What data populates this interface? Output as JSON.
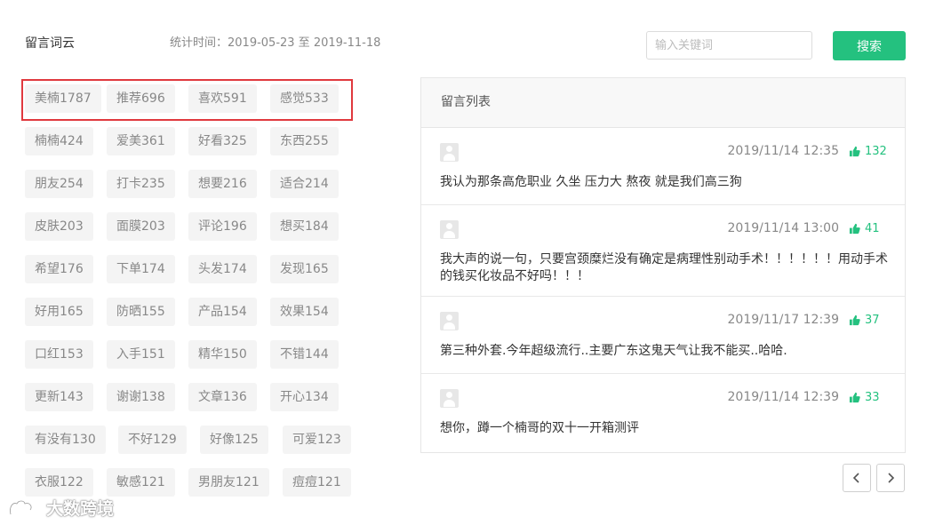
{
  "header": {
    "title": "留言词云",
    "date_range": "统计时间：2019-05-23 至 2019-11-18",
    "search_placeholder": "输入关键词",
    "search_button": "搜索"
  },
  "tags": [
    [
      "美楠1787",
      "推荐696",
      "喜欢591",
      "感觉533"
    ],
    [
      "楠楠424",
      "爱美361",
      "好看325",
      "东西255"
    ],
    [
      "朋友254",
      "打卡235",
      "想要216",
      "适合214"
    ],
    [
      "皮肤203",
      "面膜203",
      "评论196",
      "想买184"
    ],
    [
      "希望176",
      "下单174",
      "头发174",
      "发现165"
    ],
    [
      "好用165",
      "防晒155",
      "产品154",
      "效果154"
    ],
    [
      "口红153",
      "入手151",
      "精华150",
      "不错144"
    ],
    [
      "更新143",
      "谢谢138",
      "文章136",
      "开心134"
    ],
    [
      "有没有130",
      "不好129",
      "好像125",
      "可爱123"
    ],
    [
      "衣服122",
      "敏感121",
      "男朋友121",
      "痘痘121"
    ]
  ],
  "comments_panel": {
    "title": "留言列表",
    "comments": [
      {
        "time": "2019/11/14 12:35",
        "likes": "132",
        "text": "我认为那条高危职业 久坐 压力大 熬夜 就是我们高三狗"
      },
      {
        "time": "2019/11/14 13:00",
        "likes": "41",
        "text": "我大声的说一句，只要宫颈糜烂没有确定是病理性别动手术！！！！！！用动手术的钱买化妆品不好吗！！！"
      },
      {
        "time": "2019/11/17 12:39",
        "likes": "37",
        "text": "第三种外套.今年超级流行..主要广东这鬼天气让我不能买..哈哈."
      },
      {
        "time": "2019/11/14 12:39",
        "likes": "33",
        "text": "想你，蹲一个楠哥的双十一开箱测评"
      }
    ]
  },
  "watermark": "大数跨境",
  "colors": {
    "accent": "#24c17f",
    "highlight_border": "#e0393e",
    "tag_bg": "#f4f4f4"
  },
  "icons": {
    "like": "thumbs-up-icon",
    "prev": "chevron-left-icon",
    "next": "chevron-right-icon",
    "avatar": "user-avatar-icon"
  }
}
